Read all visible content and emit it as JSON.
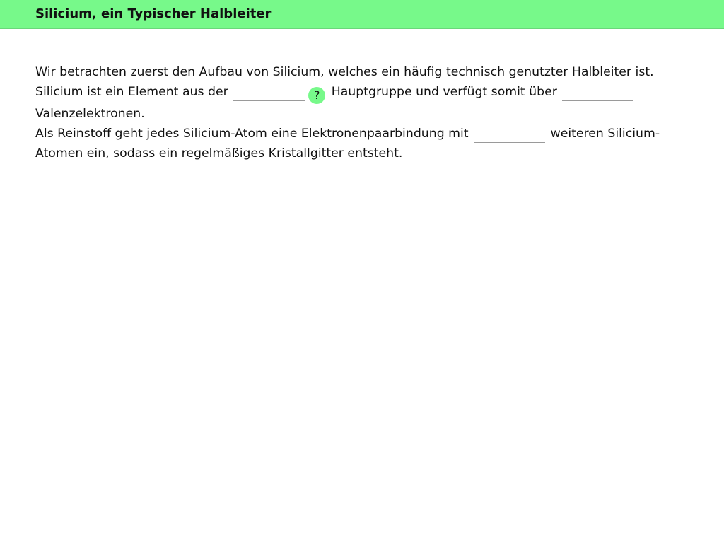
{
  "header": {
    "title": "Silicium, ein Typischer Halbleiter"
  },
  "colors": {
    "accent": "#77f98a"
  },
  "exercise": {
    "intro": "Wir betrachten zuerst den Aufbau von Silicium, welches ein häufig technisch genutzter Halbleiter ist.",
    "sentence2_part1": "Silicium ist ein Element aus der",
    "sentence2_part2": "Hauptgruppe und verfügt somit über",
    "sentence2_part3": "Valenzelektronen.",
    "sentence3_part1": "Als Reinstoff geht jedes Silicium-Atom eine Elektronenpaarbindung mit",
    "sentence3_part2": "weiteren Silicium-Atomen ein, sodass ein regelmäßiges Kristallgitter entsteht.",
    "help_label": "?",
    "help_icon": "question-mark-icon",
    "blanks": {
      "main_group": "",
      "valence_electrons": "",
      "bond_partners": ""
    }
  }
}
